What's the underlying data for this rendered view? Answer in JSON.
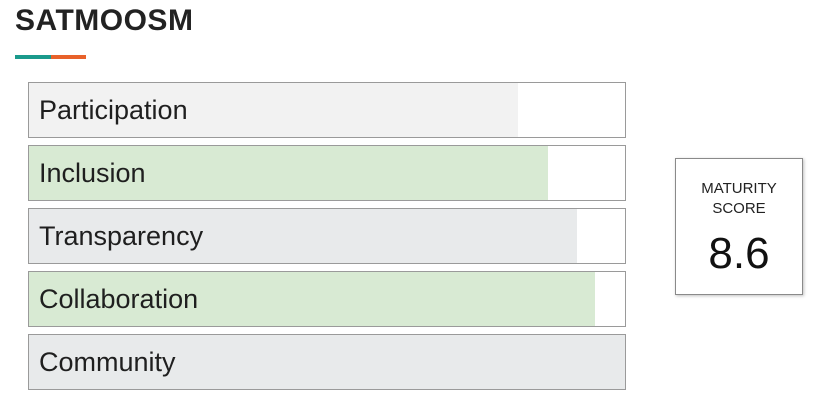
{
  "header": {
    "title": "SATMOOSM",
    "underline_colors": [
      "#1a9a8c",
      "#e8612a"
    ]
  },
  "bars": [
    {
      "label": "Participation",
      "value": 0.82,
      "fill_color": "#f2f2f2"
    },
    {
      "label": "Inclusion",
      "value": 0.87,
      "fill_color": "#d8ead3"
    },
    {
      "label": "Transparency",
      "value": 0.92,
      "fill_color": "#e8eaeb"
    },
    {
      "label": "Collaboration",
      "value": 0.95,
      "fill_color": "#d8ead3"
    },
    {
      "label": "Community",
      "value": 1.0,
      "fill_color": "#e8eaeb"
    }
  ],
  "score": {
    "label_line1": "MATURITY",
    "label_line2": "SCORE",
    "value": "8.6"
  }
}
